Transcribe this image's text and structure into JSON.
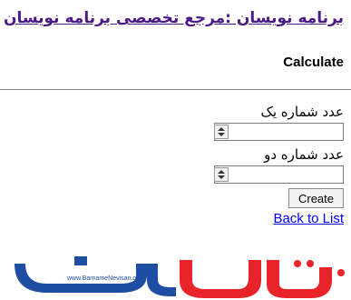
{
  "header": {
    "site_title": "برنامه نویسان :مرجع تخصصی برنامه نویسان"
  },
  "page": {
    "heading": "Calculate"
  },
  "form": {
    "field1_label": "عدد شماره یک",
    "field1_value": "",
    "field2_label": "عدد شماره دو",
    "field2_value": "",
    "create_label": "Create"
  },
  "links": {
    "back_label": "Back to List"
  },
  "logo": {
    "text": "برنامه نویسان",
    "url_text": "www.BarnameNevisan.org"
  },
  "colors": {
    "title": "#4b1a86",
    "link": "#0000ee",
    "logo_blue": "#1e4ea3",
    "logo_red": "#e8232a"
  }
}
